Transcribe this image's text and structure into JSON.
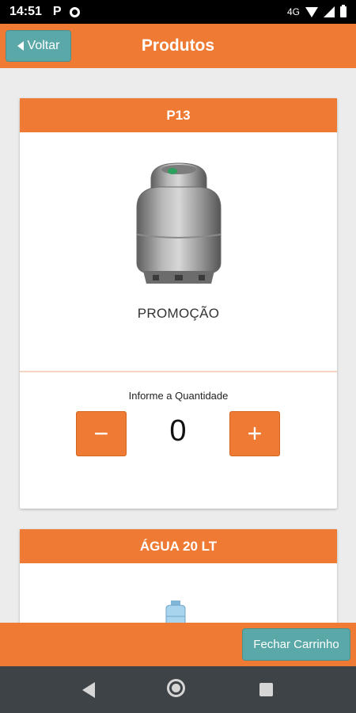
{
  "status_bar": {
    "time": "14:51",
    "app_letter": "P",
    "network": "4G"
  },
  "header": {
    "back_label": "Voltar",
    "title": "Produtos"
  },
  "products": [
    {
      "name": "P13",
      "subtitle": "PROMOÇÃO",
      "quantity_label": "Informe a Quantidade",
      "quantity": "0",
      "minus": "−",
      "plus": "+"
    },
    {
      "name": "ÁGUA 20 LT"
    }
  ],
  "footer": {
    "checkout_label": "Fechar Carrinho"
  },
  "colors": {
    "accent": "#ef7a33",
    "button_teal": "#5aa8a8",
    "nav_bar": "#3e4347"
  }
}
